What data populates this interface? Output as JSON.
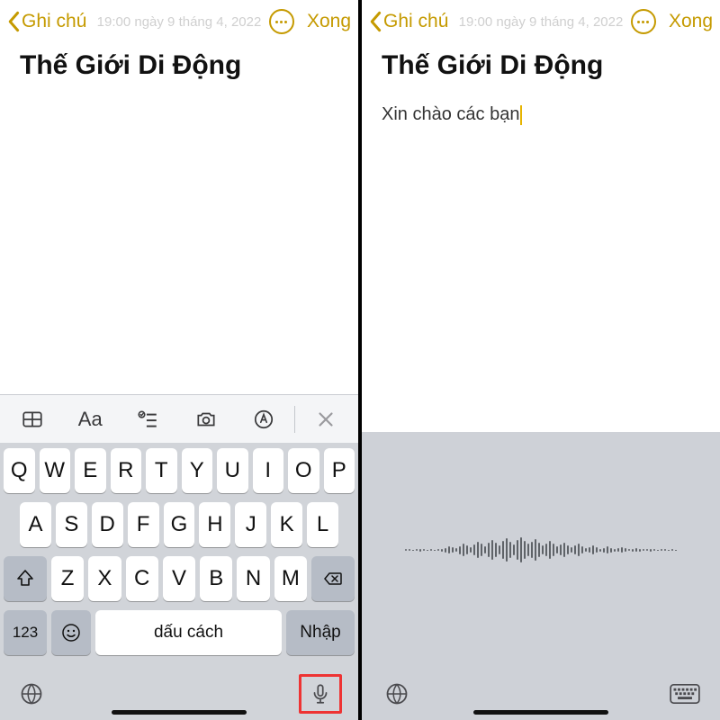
{
  "colors": {
    "accent": "#c59a00",
    "highlight_box": "#e33333"
  },
  "left": {
    "nav": {
      "back": "Ghi chú",
      "done": "Xong",
      "date": "19:00 ngày 9 tháng 4, 2022"
    },
    "note": {
      "title": "Thế Giới Di Động",
      "body": ""
    },
    "toolbar": {
      "items": [
        "table-icon",
        "text-format",
        "checklist-icon",
        "camera-icon",
        "markup-icon",
        "close-icon"
      ],
      "aa_label": "Aa"
    },
    "keyboard": {
      "row1": [
        "Q",
        "W",
        "E",
        "R",
        "T",
        "Y",
        "U",
        "I",
        "O",
        "P"
      ],
      "row2": [
        "A",
        "S",
        "D",
        "F",
        "G",
        "H",
        "J",
        "K",
        "L"
      ],
      "row3": [
        "Z",
        "X",
        "C",
        "V",
        "B",
        "N",
        "M"
      ],
      "num_label": "123",
      "space_label": "dấu cách",
      "enter_label": "Nhập"
    }
  },
  "right": {
    "nav": {
      "back": "Ghi chú",
      "done": "Xong",
      "date": "19:00 ngày 9 tháng 4, 2022"
    },
    "note": {
      "title": "Thế Giới Di Động",
      "body": "Xin chào các bạn"
    },
    "dictation": {
      "active": true
    }
  }
}
